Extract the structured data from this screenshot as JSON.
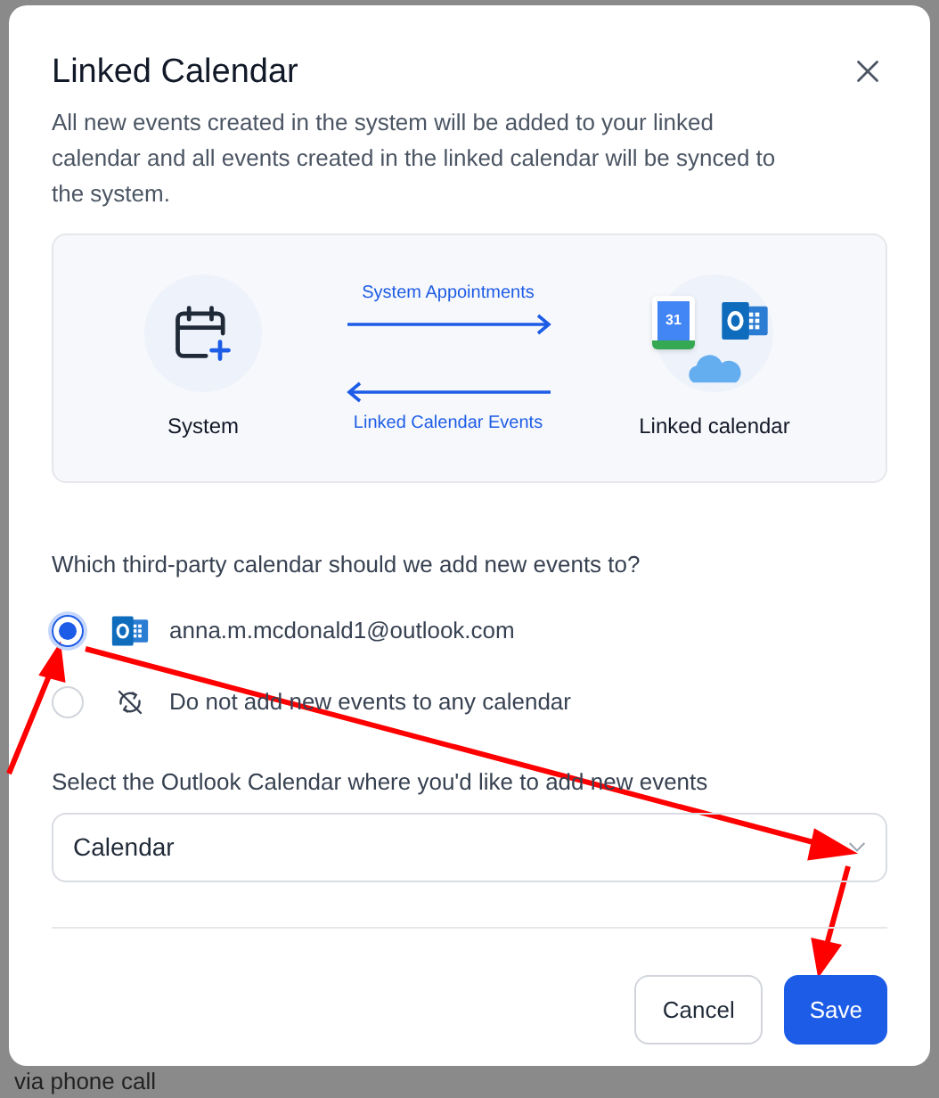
{
  "background": {
    "text": "via phone call"
  },
  "dialog": {
    "title": "Linked Calendar",
    "description": "All new events created in the system will be added to your linked calendar and all events created in the linked calendar will be synced to the system.",
    "diagram": {
      "left_label": "System",
      "right_label": "Linked calendar",
      "forward_label": "System Appointments",
      "backward_label": "Linked Calendar Events",
      "google_day": "31"
    },
    "question": "Which third-party calendar should we add new events to?",
    "options": [
      {
        "kind": "outlook",
        "label": "anna.m.mcdonald1@outlook.com",
        "selected": true
      },
      {
        "kind": "none",
        "label": "Do not add new events to any calendar",
        "selected": false
      }
    ],
    "select_label": "Select the Outlook Calendar where you'd like to add new events",
    "select_value": "Calendar",
    "buttons": [
      {
        "kind": "secondary",
        "label": "Cancel"
      },
      {
        "kind": "primary",
        "label": "Save"
      }
    ]
  }
}
